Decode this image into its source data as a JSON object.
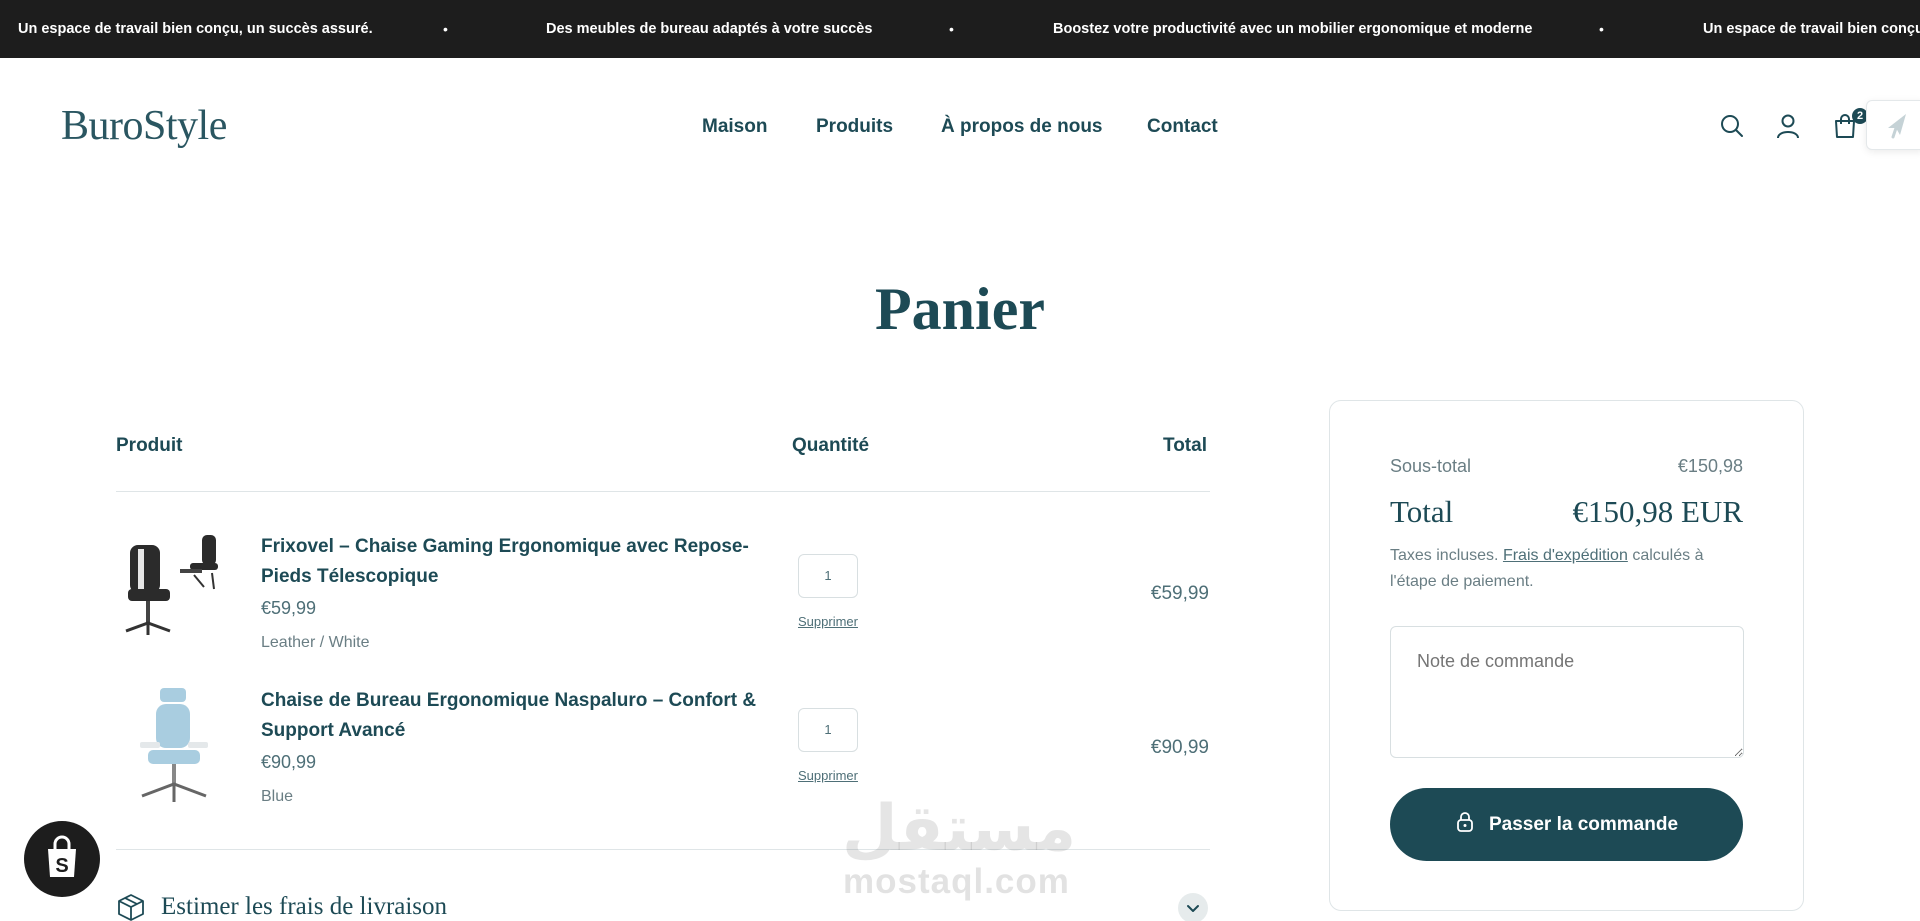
{
  "announcement": {
    "messages": [
      "Un espace de travail bien conçu, un succès assuré.",
      "Des meubles de bureau adaptés à votre succès",
      "Boostez votre productivité avec un mobilier ergonomique et moderne",
      "Un espace de travail bien conçu, u"
    ],
    "separator": "•"
  },
  "header": {
    "logo": "BuroStyle",
    "nav": [
      "Maison",
      "Produits",
      "À propos de nous",
      "Contact"
    ],
    "icons": [
      "search-icon",
      "account-icon",
      "cart-icon",
      "rocket-icon"
    ],
    "cart_count": "2"
  },
  "page": {
    "title": "Panier"
  },
  "cart": {
    "columns": {
      "product": "Produit",
      "quantity": "Quantité",
      "total": "Total"
    },
    "items": [
      {
        "title": "Frixovel – Chaise Gaming Ergonomique avec Repose-Pieds Télescopique",
        "price": "€59,99",
        "variant": "Leather / White",
        "quantity": "1",
        "remove": "Supprimer",
        "line_total": "€59,99"
      },
      {
        "title": "Chaise de Bureau Ergonomique Naspaluro – Confort & Support Avancé",
        "price": "€90,99",
        "variant": "Blue",
        "quantity": "1",
        "remove": "Supprimer",
        "line_total": "€90,99"
      }
    ],
    "shipping_estimate": "Estimer les frais de livraison"
  },
  "summary": {
    "subtotal_label": "Sous-total",
    "subtotal_value": "€150,98",
    "total_label": "Total",
    "total_value": "€150,98 EUR",
    "tax_prefix": "Taxes incluses.",
    "shipping_link": "Frais d'expédition",
    "tax_suffix": "calculés à l'étape de paiement.",
    "note_placeholder": "Note de commande",
    "checkout_label": "Passer la commande"
  },
  "watermark": {
    "arabic": "مستقل",
    "latin": "mostaql.com"
  },
  "colors": {
    "primary": "#1d4a55",
    "announcement_bg": "#1d1d1d",
    "muted": "#6a7e84",
    "border": "#dfe5e7"
  }
}
